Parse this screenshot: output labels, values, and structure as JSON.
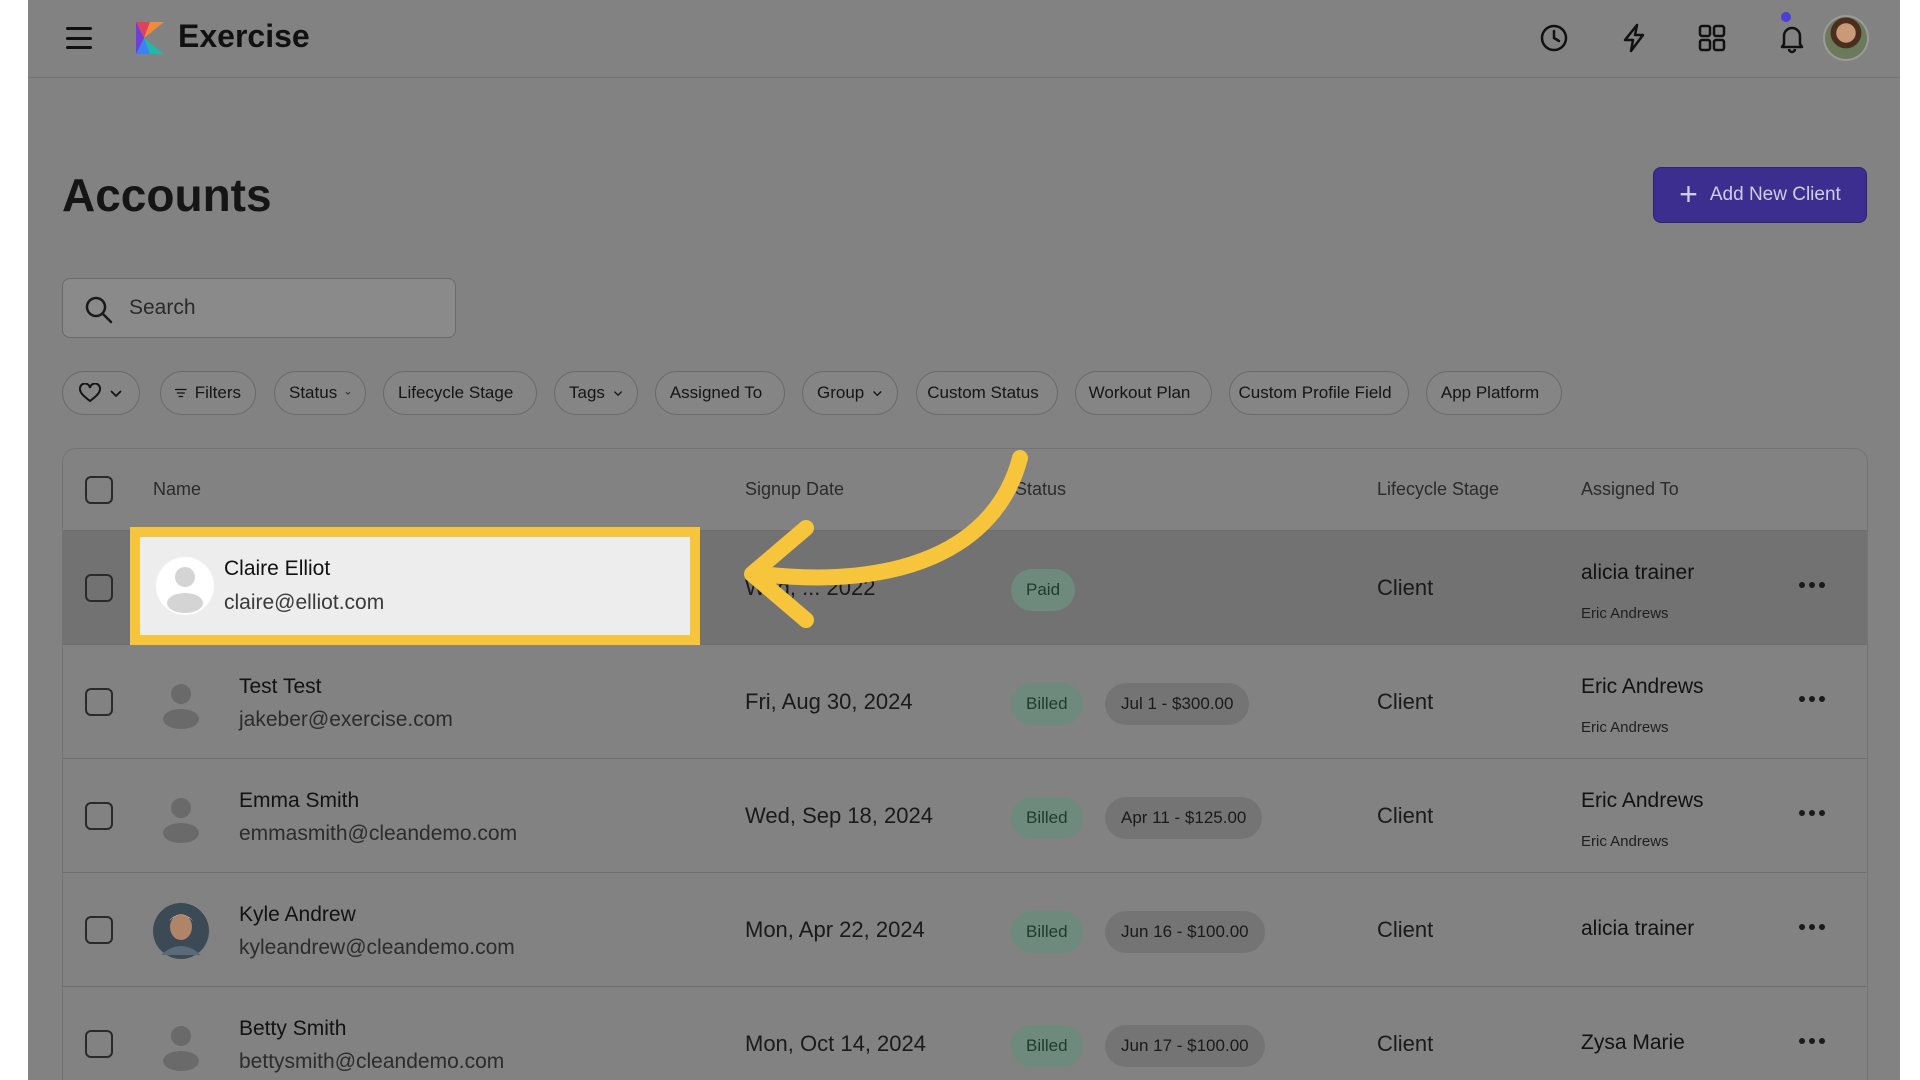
{
  "topbar": {
    "app_name": "Exercise",
    "icons": [
      "menu-icon",
      "history-icon",
      "lightning-icon",
      "apps-grid-icon",
      "bell-icon"
    ],
    "accent_color": "#4a3fd8"
  },
  "page": {
    "title": "Accounts",
    "add_button_label": "Add New Client"
  },
  "search": {
    "placeholder": "Search"
  },
  "filters": {
    "favorites_icon": "heart-icon",
    "items": [
      "Filters",
      "Status",
      "Lifecycle Stage",
      "Tags",
      "Assigned To",
      "Group",
      "Custom Status",
      "Workout Plan",
      "Custom Profile Field",
      "App Platform"
    ]
  },
  "table": {
    "columns": [
      "Name",
      "Signup Date",
      "Status",
      "Lifecycle Stage",
      "Assigned To"
    ],
    "rows": [
      {
        "name": "Claire Elliot",
        "email": "claire@elliot.com",
        "signup_date": "Wed, ... 2022",
        "status": "Paid",
        "invoice": "",
        "stage": "Client",
        "assigned": "alicia trainer",
        "assigned_sub": "Eric Andrews"
      },
      {
        "name": "Test Test",
        "email": "jakeber@exercise.com",
        "signup_date": "Fri, Aug 30, 2024",
        "status": "Billed",
        "invoice": "Jul 1 - $300.00",
        "stage": "Client",
        "assigned": "Eric Andrews",
        "assigned_sub": "Eric Andrews"
      },
      {
        "name": "Emma Smith",
        "email": "emmasmith@cleandemo.com",
        "signup_date": "Wed, Sep 18, 2024",
        "status": "Billed",
        "invoice": "Apr 11 - $125.00",
        "stage": "Client",
        "assigned": "Eric Andrews",
        "assigned_sub": "Eric Andrews"
      },
      {
        "name": "Kyle Andrew",
        "email": "kyleandrew@cleandemo.com",
        "signup_date": "Mon, Apr 22, 2024",
        "status": "Billed",
        "invoice": "Jun 16 - $100.00",
        "stage": "Client",
        "assigned": "alicia trainer",
        "assigned_sub": ""
      },
      {
        "name": "Betty Smith",
        "email": "bettysmith@cleandemo.com",
        "signup_date": "Mon, Oct 14, 2024",
        "status": "Billed",
        "invoice": "Jun 17 - $100.00",
        "stage": "Client",
        "assigned": "Zysa Marie",
        "assigned_sub": ""
      }
    ]
  },
  "callout": {
    "highlight_color": "#f7c53b"
  }
}
